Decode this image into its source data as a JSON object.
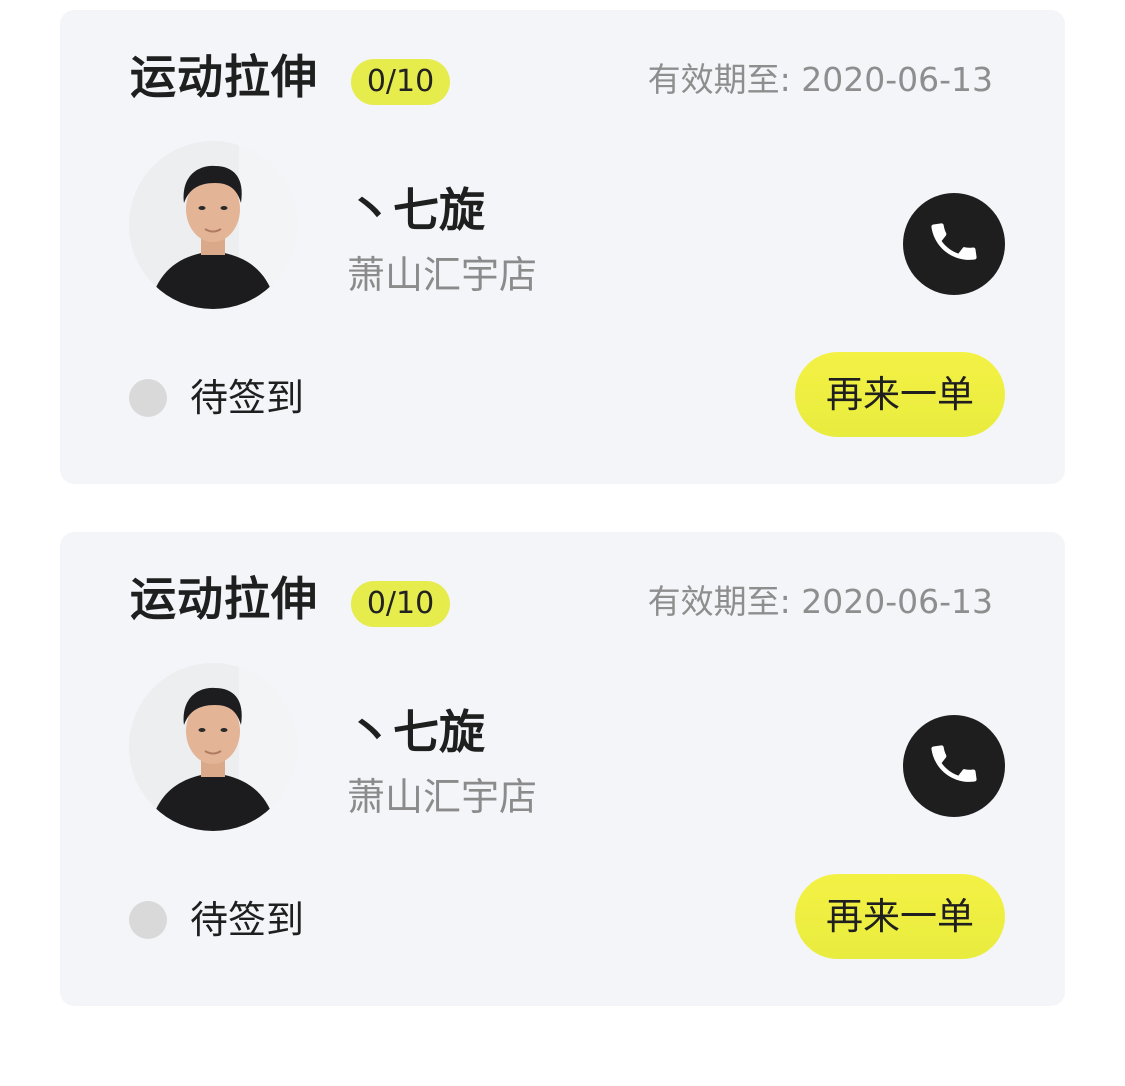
{
  "orders": [
    {
      "title": "运动拉伸",
      "count": "0/10",
      "validity_label": "有效期至:",
      "validity_date": "2020-06-13",
      "coach_name": "丶七旋",
      "store": "萧山汇宇店",
      "status": "待签到",
      "reorder_label": "再来一单",
      "phone_icon": "phone-icon"
    },
    {
      "title": "运动拉伸",
      "count": "0/10",
      "validity_label": "有效期至:",
      "validity_date": "2020-06-13",
      "coach_name": "丶七旋",
      "store": "萧山汇宇店",
      "status": "待签到",
      "reorder_label": "再来一单",
      "phone_icon": "phone-icon"
    }
  ],
  "colors": {
    "card_background": "#f4f5f9",
    "accent_yellow": "#e8ec3e",
    "dark": "#1e1e1e",
    "muted_text": "#8e8e8e",
    "status_dot": "#d9d9d9"
  }
}
